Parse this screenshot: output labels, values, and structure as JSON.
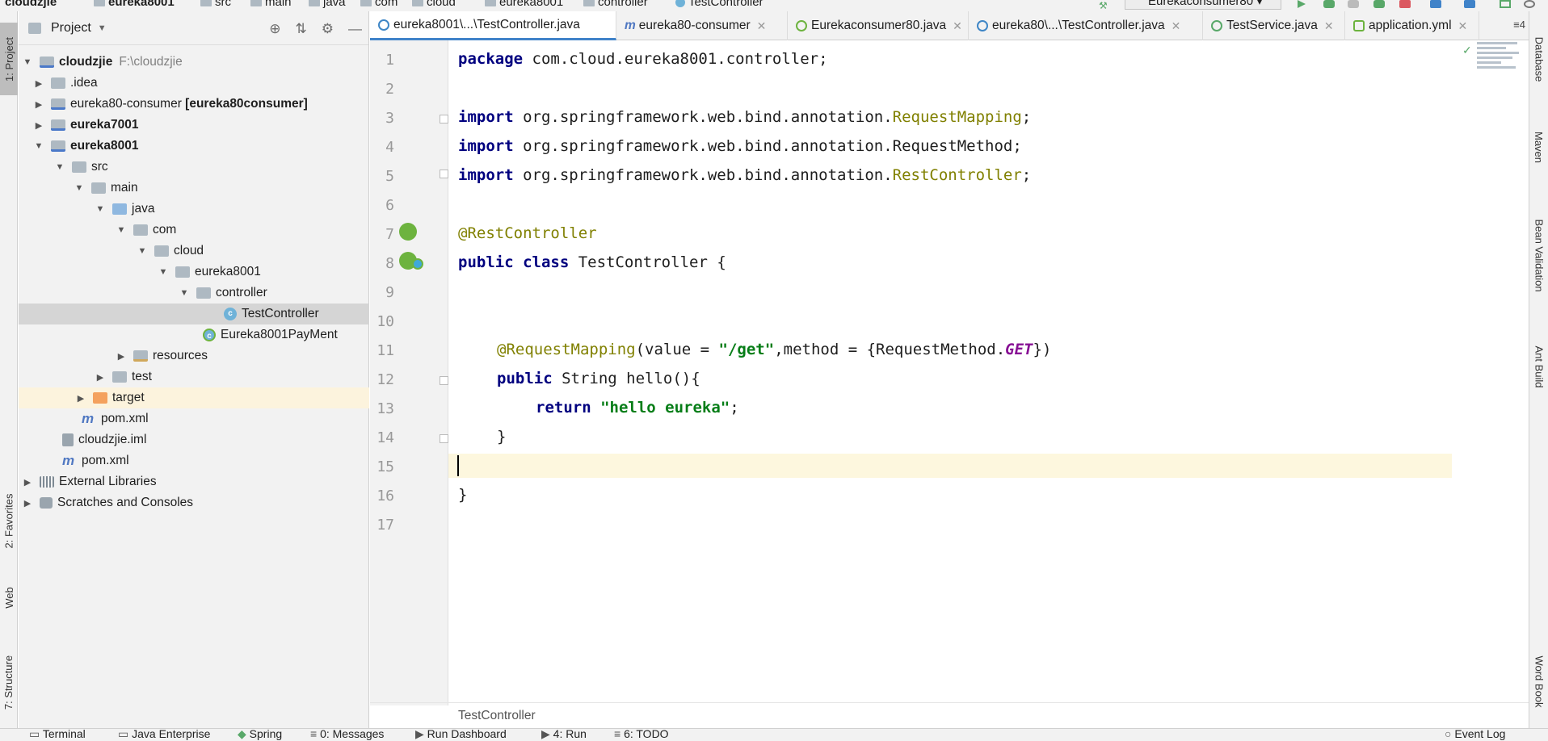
{
  "breadcrumb": {
    "items": [
      "cloudzjie",
      "eureka8001",
      "src",
      "main",
      "java",
      "com",
      "cloud",
      "eureka8001",
      "controller",
      "TestController"
    ]
  },
  "toolbar": {
    "run_config": "Eurekaconsumer80"
  },
  "left_strip": {
    "project": "1: Project",
    "favorites": "2: Favorites",
    "web": "Web",
    "structure": "7: Structure"
  },
  "right_strip": {
    "database": "Database",
    "maven": "Maven",
    "bean_validation": "Bean Validation",
    "ant_build": "Ant Build",
    "word_book": "Word Book"
  },
  "project_panel": {
    "title": "Project",
    "tree": [
      {
        "label": "cloudzjie",
        "path": "F:\\cloudzjie"
      },
      {
        "label": ".idea"
      },
      {
        "label": "eureka80-consumer",
        "suffix": "[eureka80consumer]"
      },
      {
        "label": "eureka7001"
      },
      {
        "label": "eureka8001"
      },
      {
        "label": "src"
      },
      {
        "label": "main"
      },
      {
        "label": "java"
      },
      {
        "label": "com"
      },
      {
        "label": "cloud"
      },
      {
        "label": "eureka8001"
      },
      {
        "label": "controller"
      },
      {
        "label": "TestController"
      },
      {
        "label": "Eureka8001PayMent"
      },
      {
        "label": "resources"
      },
      {
        "label": "test"
      },
      {
        "label": "target"
      },
      {
        "label": "pom.xml"
      },
      {
        "label": "cloudzjie.iml"
      },
      {
        "label": "pom.xml"
      },
      {
        "label": "External Libraries"
      },
      {
        "label": "Scratches and Consoles"
      }
    ]
  },
  "editor_tabs": {
    "tabs": [
      {
        "label": "eureka8001\\...\\TestController.java"
      },
      {
        "label": "eureka80-consumer"
      },
      {
        "label": "Eurekaconsumer80.java"
      },
      {
        "label": "eureka80\\...\\TestController.java"
      },
      {
        "label": "TestService.java"
      },
      {
        "label": "application.yml"
      }
    ],
    "overflow": "≡4"
  },
  "editor": {
    "line_numbers": [
      "1",
      "2",
      "3",
      "4",
      "5",
      "6",
      "7",
      "8",
      "9",
      "10",
      "11",
      "12",
      "13",
      "14",
      "15",
      "16",
      "17"
    ],
    "lines": {
      "l1_kw": "package",
      "l1_rest": " com.cloud.eureka8001.controller;",
      "l3_kw": "import",
      "l3_pkg": " org.springframework.web.bind.annotation.",
      "l3_cls": "RequestMapping",
      "l4_kw": "import",
      "l4_rest": " org.springframework.web.bind.annotation.RequestMethod;",
      "l5_kw": "import",
      "l5_pkg": " org.springframework.web.bind.annotation.",
      "l5_cls": "RestController",
      "l7_ann": "@RestController",
      "l8_kw1": "public",
      "l8_kw2": "class",
      "l8_rest": " TestController {",
      "l11_ann": "@RequestMapping",
      "l11_a": "(value = ",
      "l11_str": "\"/get\"",
      "l11_b": ",method = {RequestMethod.",
      "l11_enum": "GET",
      "l11_c": "})",
      "l12_kw": "public",
      "l12_rest": " String hello(){",
      "l13_kw": "return",
      "l13_str": "\"hello eureka\"",
      "l13_end": ";",
      "l14": "}",
      "l16": "}"
    },
    "breadcrumb": "TestController"
  },
  "bottom_bar": {
    "tabs": [
      "Terminal",
      "Java Enterprise",
      "Spring",
      "0: Messages",
      "Run Dashboard",
      "4: Run",
      "6: TODO",
      "Event Log"
    ]
  }
}
